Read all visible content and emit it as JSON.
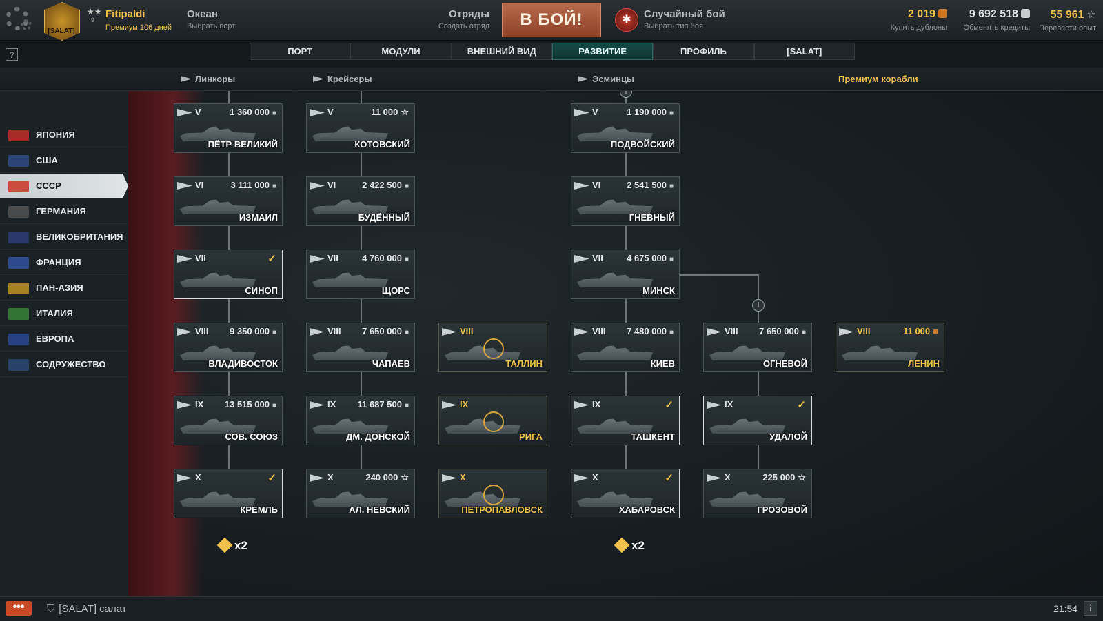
{
  "header": {
    "player": {
      "name": "Fitipaldi",
      "premium": "Премиум 106 дней",
      "rank_stars": "★★",
      "level": "9",
      "clan_tag": "[SALAT]"
    },
    "port": {
      "title": "Океан",
      "sub": "Выбрать порт"
    },
    "division": {
      "title": "Отряды",
      "sub": "Создать отряд"
    },
    "battle_button": "В БОЙ!",
    "battle_type": {
      "title": "Случайный бой",
      "sub": "Выбрать тип боя"
    },
    "currencies": [
      {
        "value": "2 019",
        "label": "Купить дублоны",
        "color": "#f0c24b"
      },
      {
        "value": "9 692 518",
        "label": "Обменять кредиты",
        "color": "#e0e4e6"
      },
      {
        "value": "55 961",
        "label": "Перевести опыт",
        "color": "#f0c24b"
      }
    ]
  },
  "tabs": [
    "ПОРТ",
    "МОДУЛИ",
    "ВНЕШНИЙ ВИД",
    "РАЗВИТИЕ",
    "ПРОФИЛЬ",
    "[SALAT]"
  ],
  "help": "?",
  "classes": {
    "battleships": "Линкоры",
    "cruisers": "Крейсеры",
    "destroyers": "Эсминцы",
    "premium": "Премиум корабли"
  },
  "nations": [
    {
      "name": "ЯПОНИЯ",
      "color": "#c9302c"
    },
    {
      "name": "США",
      "color": "#2f4f8f"
    },
    {
      "name": "СССР",
      "color": "#cc2a1a"
    },
    {
      "name": "ГЕРМАНИЯ",
      "color": "#555555"
    },
    {
      "name": "ВЕЛИКОБРИТАНИЯ",
      "color": "#2a3f7a"
    },
    {
      "name": "ФРАНЦИЯ",
      "color": "#3355aa"
    },
    {
      "name": "ПАН-АЗИЯ",
      "color": "#c89a20"
    },
    {
      "name": "ИТАЛИЯ",
      "color": "#3a8a3a"
    },
    {
      "name": "ЕВРОПА",
      "color": "#2a4a9a"
    },
    {
      "name": "СОДРУЖЕСТВО",
      "color": "#2a4a7a"
    }
  ],
  "ships": [
    {
      "tier": "V",
      "price": "1 360 000",
      "name": "ПЁТР ВЕЛИКИЙ",
      "status": "locked"
    },
    {
      "tier": "V",
      "price": "11 000",
      "name": "КОТОВСКИЙ",
      "status": "xp"
    },
    {
      "tier": "V",
      "price": "1 190 000",
      "name": "ПОДВОЙСКИЙ",
      "status": "locked"
    },
    {
      "tier": "VI",
      "price": "3 111 000",
      "name": "ИЗМАИЛ",
      "status": "locked"
    },
    {
      "tier": "VI",
      "price": "2 422 500",
      "name": "БУДЁННЫЙ",
      "status": "locked"
    },
    {
      "tier": "VI",
      "price": "2 541 500",
      "name": "ГНЕВНЫЙ",
      "status": "locked"
    },
    {
      "tier": "VII",
      "price": "",
      "name": "СИНОП",
      "status": "researched"
    },
    {
      "tier": "VII",
      "price": "4 760 000",
      "name": "ЩОРС",
      "status": "locked"
    },
    {
      "tier": "VII",
      "price": "4 675 000",
      "name": "МИНСК",
      "status": "locked"
    },
    {
      "tier": "VIII",
      "price": "9 350 000",
      "name": "ВЛАДИВОСТОК",
      "status": "locked"
    },
    {
      "tier": "VIII",
      "price": "7 650 000",
      "name": "ЧАПАЕВ",
      "status": "locked"
    },
    {
      "tier": "VIII",
      "price": "",
      "name": "ТАЛЛИН",
      "status": "special"
    },
    {
      "tier": "VIII",
      "price": "7 480 000",
      "name": "КИЕВ",
      "status": "locked"
    },
    {
      "tier": "VIII",
      "price": "7 650 000",
      "name": "ОГНЕВОЙ",
      "status": "locked"
    },
    {
      "tier": "VIII",
      "price": "11 000",
      "name": "ЛЕНИН",
      "status": "premium"
    },
    {
      "tier": "IX",
      "price": "13 515 000",
      "name": "СОВ. СОЮЗ",
      "status": "locked"
    },
    {
      "tier": "IX",
      "price": "11 687 500",
      "name": "ДМ. ДОНСКОЙ",
      "status": "locked"
    },
    {
      "tier": "IX",
      "price": "",
      "name": "РИГА",
      "status": "special"
    },
    {
      "tier": "IX",
      "price": "",
      "name": "ТАШКЕНТ",
      "status": "researched"
    },
    {
      "tier": "IX",
      "price": "",
      "name": "УДАЛОЙ",
      "status": "researched"
    },
    {
      "tier": "X",
      "price": "",
      "name": "КРЕМЛЬ",
      "status": "researched"
    },
    {
      "tier": "X",
      "price": "240 000",
      "name": "АЛ. НЕВСКИЙ",
      "status": "xp"
    },
    {
      "tier": "X",
      "price": "",
      "name": "ПЕТРОПАВЛОВСК",
      "status": "special"
    },
    {
      "tier": "X",
      "price": "",
      "name": "ХАБАРОВСК",
      "status": "researched"
    },
    {
      "tier": "X",
      "price": "225 000",
      "name": "ГРОЗОВОЙ",
      "status": "xp"
    }
  ],
  "multipliers": [
    "x2",
    "x2"
  ],
  "info_marks": [
    "i",
    "i"
  ],
  "bottom": {
    "chat_button": "•••",
    "clan_chat": "[SALAT] салат",
    "time": "21:54",
    "info": "i"
  }
}
